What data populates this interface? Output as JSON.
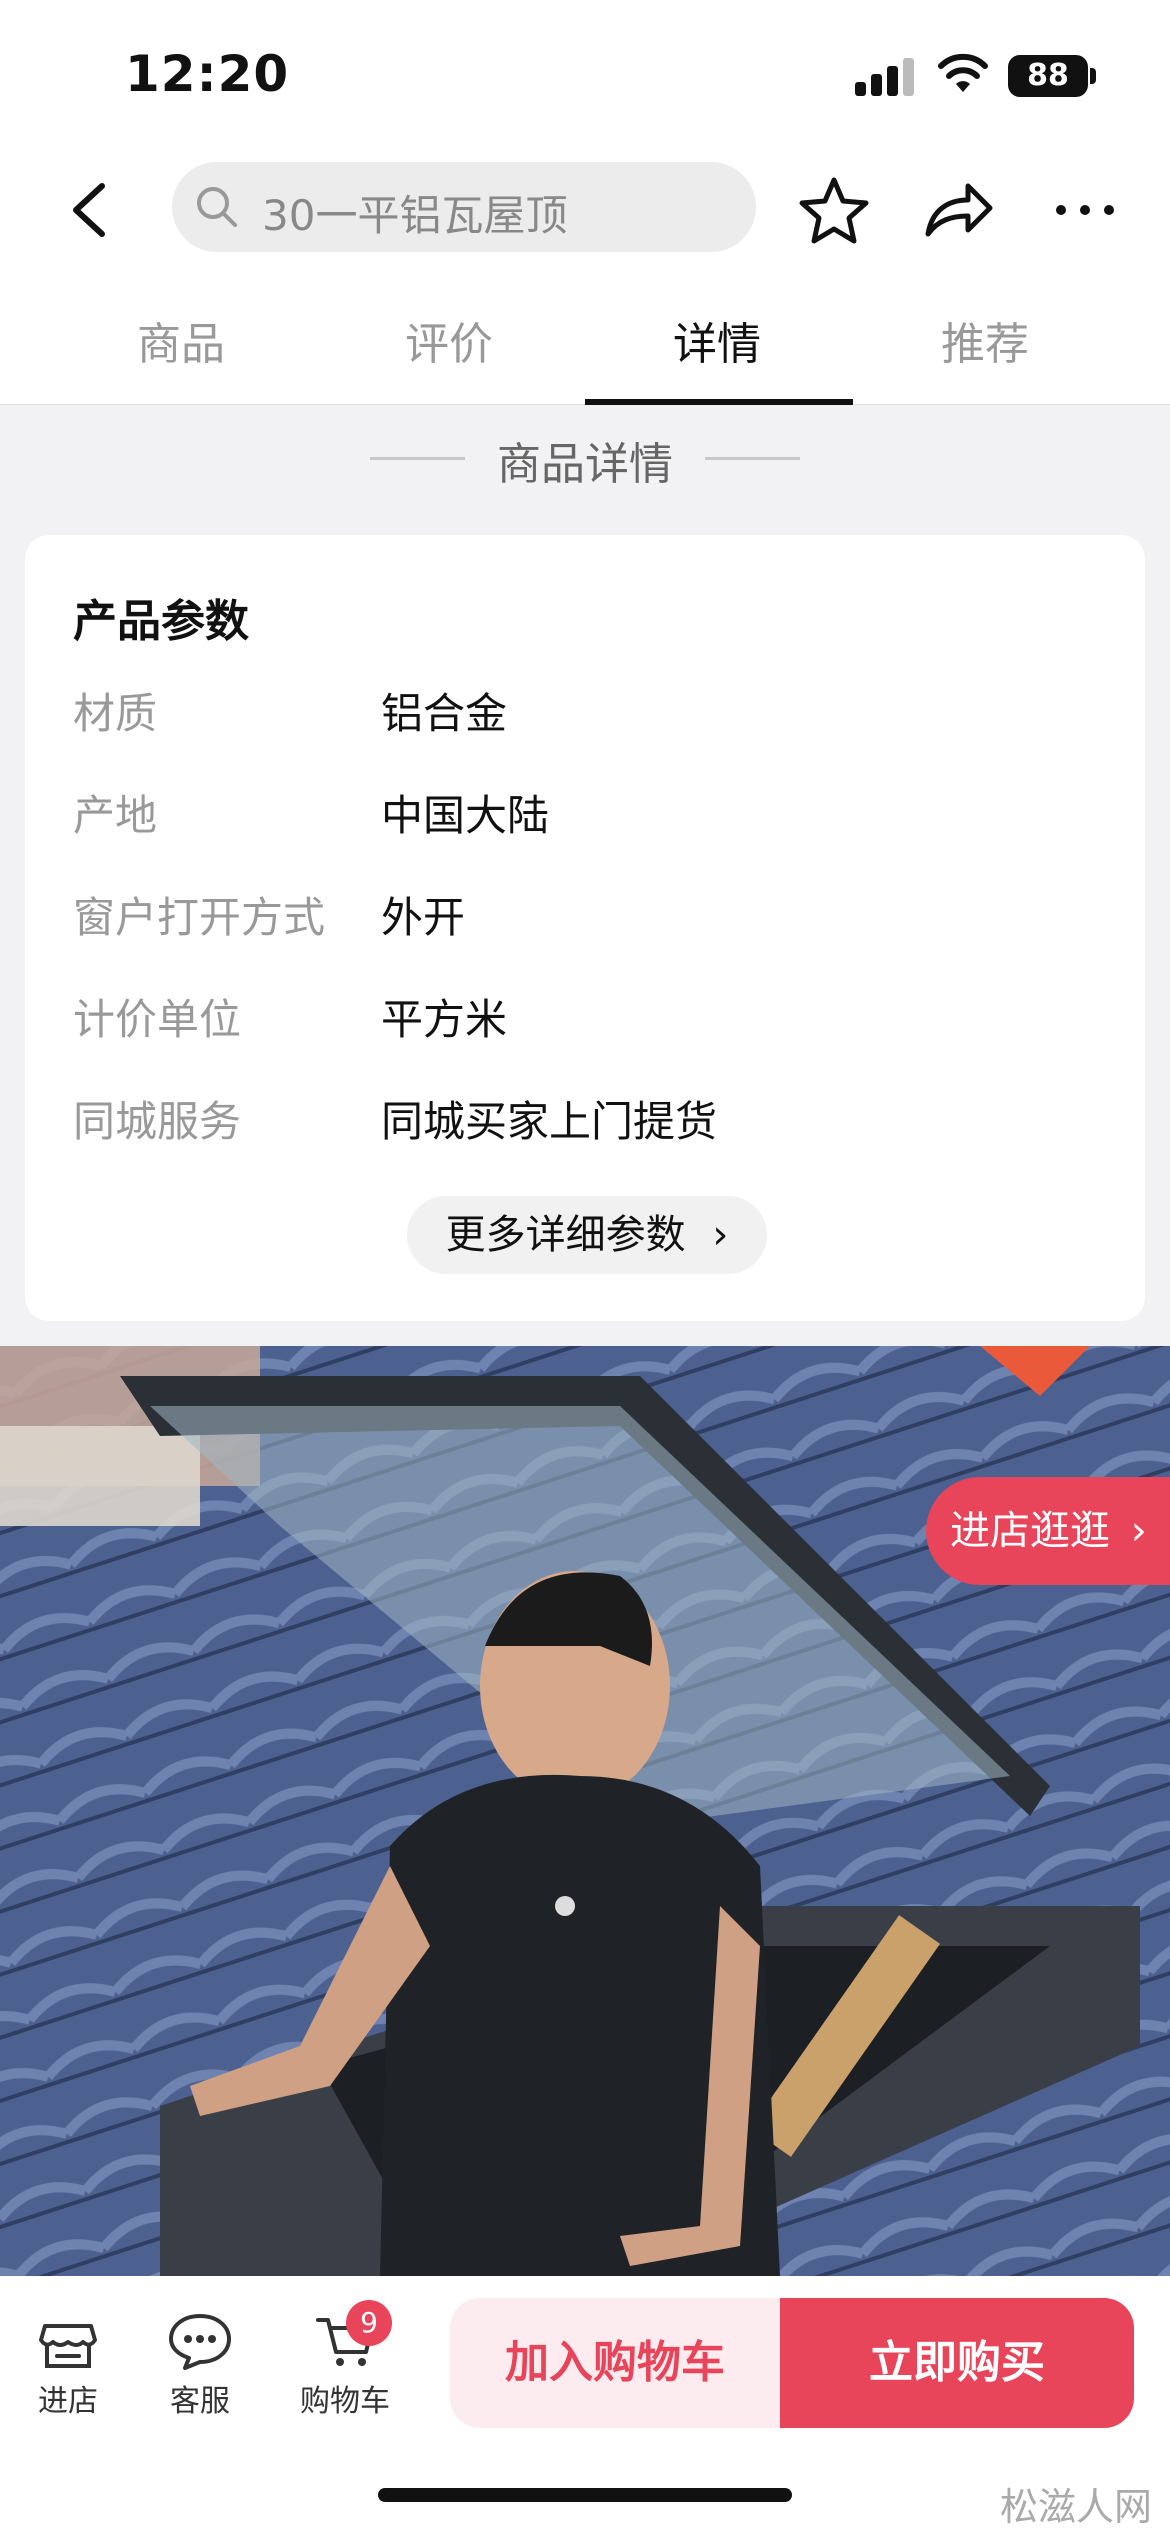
{
  "status_bar": {
    "time": "12:20",
    "battery": "88"
  },
  "nav": {
    "search_text": "30一平铝瓦屋顶"
  },
  "tabs": [
    {
      "label": "商品"
    },
    {
      "label": "评价"
    },
    {
      "label": "详情"
    },
    {
      "label": "推荐"
    }
  ],
  "section_title": "商品详情",
  "params": {
    "title": "产品参数",
    "rows": [
      {
        "key": "材质",
        "value": "铝合金"
      },
      {
        "key": "产地",
        "value": "中国大陆"
      },
      {
        "key": "窗户打开方式",
        "value": "外开"
      },
      {
        "key": "计价单位",
        "value": "平方米"
      },
      {
        "key": "同城服务",
        "value": "同城买家上门提货"
      }
    ],
    "more_label": "更多详细参数"
  },
  "store_pill": "进店逛逛",
  "bottom_bar": {
    "store": "进店",
    "service": "客服",
    "cart": "购物车",
    "cart_count": "9",
    "add_to_cart": "加入购物车",
    "buy_now": "立即购买"
  },
  "watermark": "松滋人网",
  "colors": {
    "accent": "#e8445a",
    "background": "#f2f2f4"
  }
}
